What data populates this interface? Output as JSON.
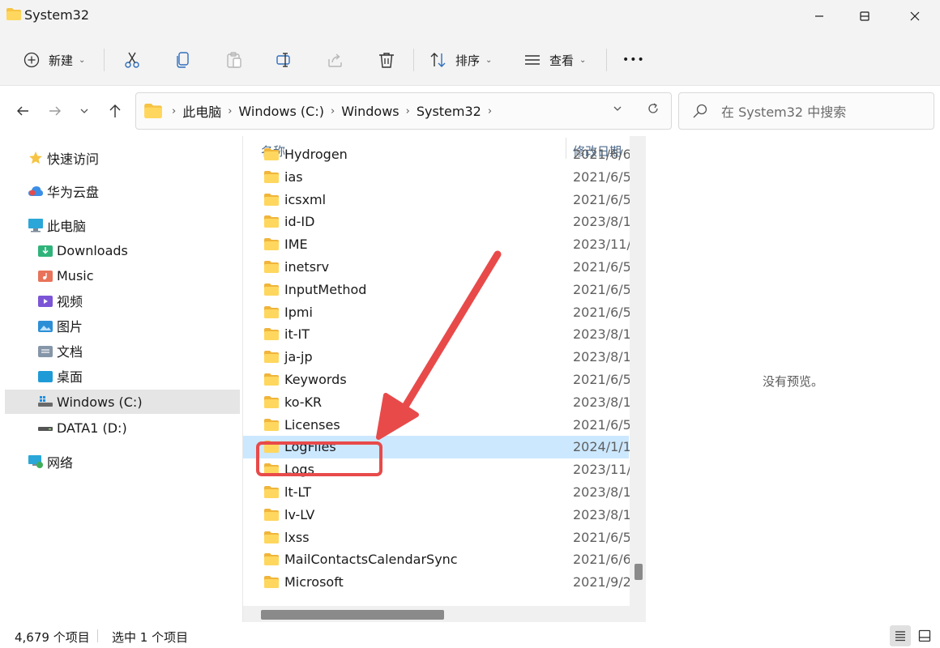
{
  "window": {
    "title": "System32",
    "minimize": "—",
    "maximize": "☐",
    "close": "✕"
  },
  "toolbar": {
    "new_label": "新建",
    "sort_label": "排序",
    "view_label": "查看",
    "more_label": "•••"
  },
  "address": {
    "crumbs": [
      "此电脑",
      "Windows (C:)",
      "Windows",
      "System32"
    ]
  },
  "search": {
    "placeholder": "在 System32 中搜索"
  },
  "sidebar": {
    "items": [
      {
        "label": "快速访问",
        "icon": "star-icon"
      },
      {
        "label": "华为云盘",
        "icon": "cloud-icon"
      },
      {
        "label": "此电脑",
        "icon": "computer-icon"
      },
      {
        "label": "Downloads",
        "icon": "downloads-icon"
      },
      {
        "label": "Music",
        "icon": "music-icon"
      },
      {
        "label": "视频",
        "icon": "video-icon"
      },
      {
        "label": "图片",
        "icon": "pictures-icon"
      },
      {
        "label": "文档",
        "icon": "documents-icon"
      },
      {
        "label": "桌面",
        "icon": "desktop-icon"
      },
      {
        "label": "Windows (C:)",
        "icon": "windows-drive-icon"
      },
      {
        "label": "DATA1 (D:)",
        "icon": "drive-icon"
      },
      {
        "label": "网络",
        "icon": "network-icon"
      }
    ]
  },
  "filelist": {
    "col_name": "名称",
    "col_date": "修改日期",
    "rows": [
      {
        "name": "Hydrogen",
        "date": "2021/6/6"
      },
      {
        "name": "ias",
        "date": "2021/6/5"
      },
      {
        "name": "icsxml",
        "date": "2021/6/5"
      },
      {
        "name": "id-ID",
        "date": "2023/8/1"
      },
      {
        "name": "IME",
        "date": "2023/11/"
      },
      {
        "name": "inetsrv",
        "date": "2021/6/5"
      },
      {
        "name": "InputMethod",
        "date": "2021/6/5"
      },
      {
        "name": "Ipmi",
        "date": "2021/6/5"
      },
      {
        "name": "it-IT",
        "date": "2023/8/1"
      },
      {
        "name": "ja-jp",
        "date": "2023/8/1"
      },
      {
        "name": "Keywords",
        "date": "2021/6/5"
      },
      {
        "name": "ko-KR",
        "date": "2023/8/1"
      },
      {
        "name": "Licenses",
        "date": "2021/6/5"
      },
      {
        "name": "LogFiles",
        "date": "2024/1/1"
      },
      {
        "name": "Logs",
        "date": "2023/11/"
      },
      {
        "name": "lt-LT",
        "date": "2023/8/1"
      },
      {
        "name": "lv-LV",
        "date": "2023/8/1"
      },
      {
        "name": "lxss",
        "date": "2021/6/5"
      },
      {
        "name": "MailContactsCalendarSync",
        "date": "2021/6/6"
      },
      {
        "name": "Microsoft",
        "date": "2021/9/2"
      }
    ]
  },
  "preview": {
    "empty_text": "没有预览。"
  },
  "status": {
    "count_text": "4,679 个项目",
    "selected_text": "选中 1 个项目"
  },
  "colors": {
    "folder": "#f6c343",
    "selection": "#cce8ff",
    "annotation": "#e84a4a"
  }
}
